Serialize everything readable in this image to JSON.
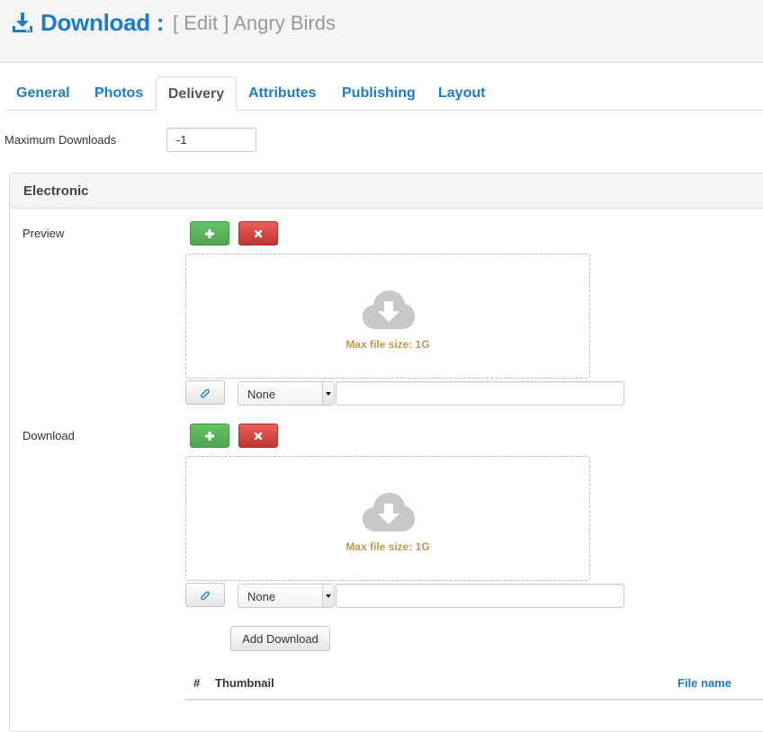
{
  "header": {
    "title": "Download :",
    "subtitle": "[ Edit ] Angry Birds",
    "icon": "download-icon"
  },
  "tabs": [
    {
      "label": "General",
      "active": false
    },
    {
      "label": "Photos",
      "active": false
    },
    {
      "label": "Delivery",
      "active": true
    },
    {
      "label": "Attributes",
      "active": false
    },
    {
      "label": "Publishing",
      "active": false
    },
    {
      "label": "Layout",
      "active": false
    }
  ],
  "max_downloads": {
    "label": "Maximum Downloads",
    "value": "-1"
  },
  "electronic": {
    "title": "Electronic",
    "preview": {
      "label": "Preview",
      "dropzone_text": "Max file size: 1G",
      "select_value": "None",
      "text_value": ""
    },
    "download": {
      "label": "Download",
      "dropzone_text": "Max file size: 1G",
      "select_value": "None",
      "text_value": ""
    },
    "add_download_label": "Add Download",
    "table": {
      "columns": [
        "#",
        "Thumbnail",
        "File name"
      ]
    }
  },
  "colors": {
    "primary": "#1c7cc7",
    "success": "#51a351",
    "danger": "#bd362f",
    "warning_text": "#c09853"
  }
}
